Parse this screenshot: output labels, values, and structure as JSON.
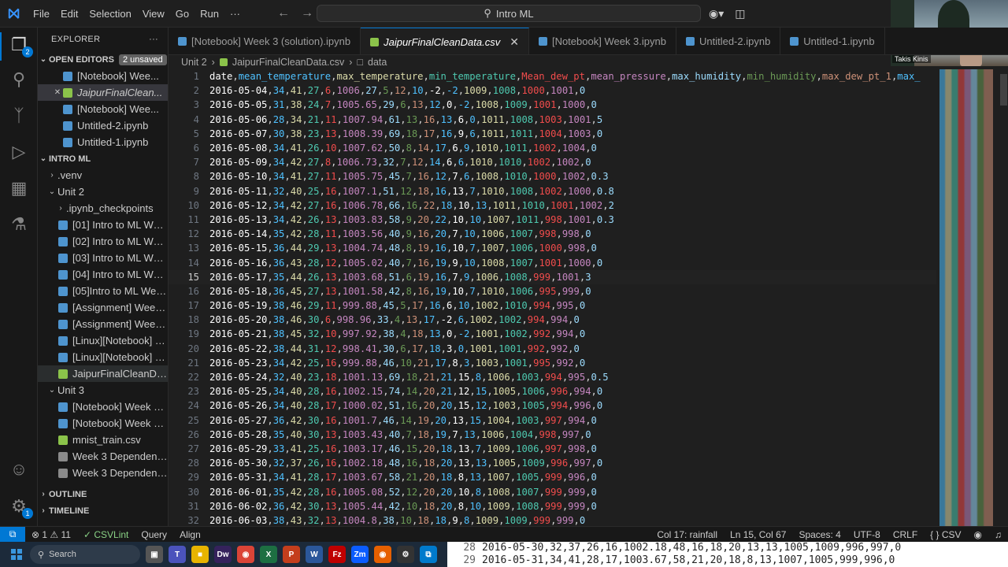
{
  "titlebar": {
    "menu": [
      "File",
      "Edit",
      "Selection",
      "View",
      "Go",
      "Run",
      "···"
    ],
    "search_text": "Intro ML"
  },
  "activity": {
    "explorer_badge": "2",
    "accounts_badge": "1"
  },
  "sidebar": {
    "title": "EXPLORER",
    "open_editors_label": "OPEN EDITORS",
    "unsaved_label": "2 unsaved",
    "open_editors": [
      {
        "label": "[Notebook] Wee...",
        "icon": "notebook-icon"
      },
      {
        "label": "JaipurFinalClean...",
        "icon": "csv-icon",
        "italic": true,
        "selected": true
      },
      {
        "label": "[Notebook] Wee...",
        "icon": "notebook-icon"
      },
      {
        "label": "Untitled-2.ipynb",
        "icon": "notebook-icon"
      },
      {
        "label": "Untitled-1.ipynb",
        "icon": "notebook-icon"
      }
    ],
    "workspace_label": "INTRO ML",
    "tree": [
      {
        "label": ".venv",
        "indent": 1,
        "chev": "closed"
      },
      {
        "label": "Unit 2",
        "indent": 1,
        "chev": "open"
      },
      {
        "label": ".ipynb_checkpoints",
        "indent": 2,
        "chev": "closed"
      },
      {
        "label": "[01] Intro to ML Wee...",
        "indent": 2,
        "icon": "notebook-icon"
      },
      {
        "label": "[02] Intro to ML Wee...",
        "indent": 2,
        "icon": "notebook-icon"
      },
      {
        "label": "[03] Intro to ML Wee...",
        "indent": 2,
        "icon": "notebook-icon"
      },
      {
        "label": "[04] Intro to ML Wee...",
        "indent": 2,
        "icon": "notebook-icon"
      },
      {
        "label": "[05]Intro to ML Week...",
        "indent": 2,
        "icon": "notebook-icon"
      },
      {
        "label": "[Assignment] Week 2...",
        "indent": 2,
        "icon": "notebook-icon"
      },
      {
        "label": "[Assignment] Week 2...",
        "indent": 2,
        "icon": "notebook-icon"
      },
      {
        "label": "[Linux][Notebook] Int...",
        "indent": 2,
        "icon": "notebook-icon"
      },
      {
        "label": "[Linux][Notebook] Int...",
        "indent": 2,
        "icon": "notebook-icon"
      },
      {
        "label": "JaipurFinalCleanData....",
        "indent": 2,
        "icon": "csv-icon",
        "active": true
      },
      {
        "label": "Unit 3",
        "indent": 1,
        "chev": "open"
      },
      {
        "label": "[Notebook] Week 3 (...",
        "indent": 2,
        "icon": "notebook-icon"
      },
      {
        "label": "[Notebook] Week 3.i...",
        "indent": 2,
        "icon": "notebook-icon"
      },
      {
        "label": "mnist_train.csv",
        "indent": 2,
        "icon": "csv-icon"
      },
      {
        "label": "Week 3 Dependencie...",
        "indent": 2,
        "icon": "file-icon"
      },
      {
        "label": "Week 3 Dependencie...",
        "indent": 2,
        "icon": "file-icon"
      }
    ],
    "outline_label": "OUTLINE",
    "timeline_label": "TIMELINE"
  },
  "tabs": [
    {
      "label": "[Notebook] Week 3 (solution).ipynb",
      "icon": "notebook-icon"
    },
    {
      "label": "JaipurFinalCleanData.csv",
      "icon": "csv-icon",
      "active": true,
      "italic": true
    },
    {
      "label": "[Notebook] Week 3.ipynb",
      "icon": "notebook-icon"
    },
    {
      "label": "Untitled-2.ipynb",
      "icon": "notebook-icon"
    },
    {
      "label": "Untitled-1.ipynb",
      "icon": "notebook-icon"
    }
  ],
  "breadcrumb": [
    "Unit 2",
    "JaipurFinalCleanData.csv",
    "data"
  ],
  "editor": {
    "current_line": 15,
    "header": "date,mean_temperature,max_temperature,min_temperature,Mean_dew_pt,mean_pressure,max_humidity,min_humidity,max_dew_pt_1,max_",
    "rows": [
      "2016-05-04,34,41,27,6,1006,27,5,12,10,-2,-2,1009,1008,1000,1001,0",
      "2016-05-05,31,38,24,7,1005.65,29,6,13,12,0,-2,1008,1009,1001,1000,0",
      "2016-05-06,28,34,21,11,1007.94,61,13,16,13,6,0,1011,1008,1003,1001,5",
      "2016-05-07,30,38,23,13,1008.39,69,18,17,16,9,6,1011,1011,1004,1003,0",
      "2016-05-08,34,41,26,10,1007.62,50,8,14,17,6,9,1010,1011,1002,1004,0",
      "2016-05-09,34,42,27,8,1006.73,32,7,12,14,6,6,1010,1010,1002,1002,0",
      "2016-05-10,34,41,27,11,1005.75,45,7,16,12,7,6,1008,1010,1000,1002,0.3",
      "2016-05-11,32,40,25,16,1007.1,51,12,18,16,13,7,1010,1008,1002,1000,0.8",
      "2016-05-12,34,42,27,16,1006.78,66,16,22,18,10,13,1011,1010,1001,1002,2",
      "2016-05-13,34,42,26,13,1003.83,58,9,20,22,10,10,1007,1011,998,1001,0.3",
      "2016-05-14,35,42,28,11,1003.56,40,9,16,20,7,10,1006,1007,998,998,0",
      "2016-05-15,36,44,29,13,1004.74,48,8,19,16,10,7,1007,1006,1000,998,0",
      "2016-05-16,36,43,28,12,1005.02,40,7,16,19,9,10,1008,1007,1001,1000,0",
      "2016-05-17,35,44,26,13,1003.68,51,6,19,16,7,9,1006,1008,999,1001,3",
      "2016-05-18,36,45,27,13,1001.58,42,8,16,19,10,7,1010,1006,995,999,0",
      "2016-05-19,38,46,29,11,999.88,45,5,17,16,6,10,1002,1010,994,995,0",
      "2016-05-20,38,46,30,6,998.96,33,4,13,17,-2,6,1002,1002,994,994,0",
      "2016-05-21,38,45,32,10,997.92,38,4,18,13,0,-2,1001,1002,992,994,0",
      "2016-05-22,38,44,31,12,998.41,30,6,17,18,3,0,1001,1001,992,992,0",
      "2016-05-23,34,42,25,16,999.88,46,10,21,17,8,3,1003,1001,995,992,0",
      "2016-05-24,32,40,23,18,1001.13,69,18,21,21,15,8,1006,1003,994,995,0.5",
      "2016-05-25,34,40,28,16,1002.15,74,14,20,21,12,15,1005,1006,996,994,0",
      "2016-05-26,34,40,28,17,1000.02,51,16,20,20,15,12,1003,1005,994,996,0",
      "2016-05-27,36,42,30,16,1001.7,46,14,19,20,13,15,1004,1003,997,994,0",
      "2016-05-28,35,40,30,13,1003.43,40,7,18,19,7,13,1006,1004,998,997,0",
      "2016-05-29,33,41,25,16,1003.17,46,15,20,18,13,7,1009,1006,997,998,0",
      "2016-05-30,32,37,26,16,1002.18,48,16,18,20,13,13,1005,1009,996,997,0",
      "2016-05-31,34,41,28,17,1003.67,58,21,20,18,8,13,1007,1005,999,996,0",
      "2016-06-01,35,42,28,16,1005.08,52,12,20,20,10,8,1008,1007,999,999,0",
      "2016-06-02,36,42,30,13,1005.44,42,10,18,20,8,10,1009,1008,999,999,0",
      "2016-06-03,38,43,32,13,1004.8,38,10,18,18,9,8,1009,1009,999,999,0"
    ]
  },
  "statusbar": {
    "problems": "⊗ 1 ⚠ 11",
    "csvlint": "✓ CSVLint",
    "query": "Query",
    "align": "Align",
    "col_info": "Col 17: rainfall",
    "position": "Ln 15, Col 67",
    "spaces": "Spaces: 4",
    "encoding": "UTF-8",
    "eol": "CRLF",
    "language": "{ } CSV"
  },
  "taskbar": {
    "search_label": "Search"
  },
  "webcam": {
    "name": "Takis Kinis"
  },
  "overlay": {
    "lines": [
      {
        "n": "28",
        "text": "2016-05-30,32,37,26,16,1002.18,48,16,18,20,13,13,1005,1009,996,997,0"
      },
      {
        "n": "29",
        "text": "2016-05-31,34,41,28,17,1003.67,58,21,20,18,8,13,1007,1005,999,996,0"
      }
    ]
  },
  "colors": {
    "accent": "#0078d4",
    "editor_bg": "#1f1f1f",
    "sidebar_bg": "#181818"
  }
}
